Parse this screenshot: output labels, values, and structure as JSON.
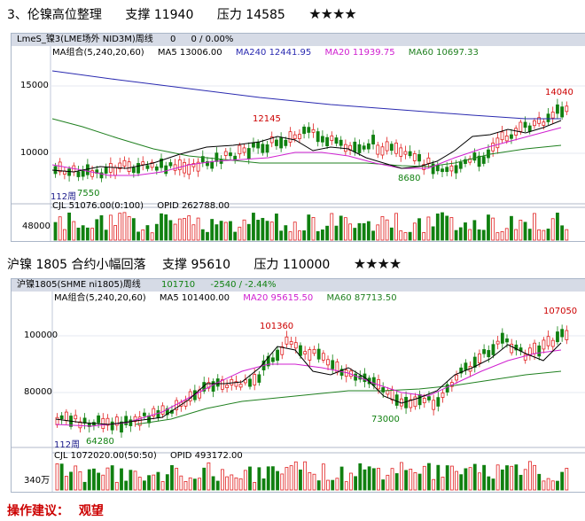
{
  "heading1": {
    "title": "3、伦镍高位整理",
    "support_label": "支撑",
    "support": "11940",
    "pressure_label": "压力",
    "pressure": "14585",
    "stars": "★★★★"
  },
  "panel1": {
    "title_bar": {
      "symbol": "LmeS_镍3(LME场外 NID3M)周线",
      "value": "0",
      "change": "0 / 0.00%"
    },
    "ma_row": {
      "label": "MA组合(5,240,20,60)",
      "ma5": "MA5 13006.00",
      "ma240": "MA240 12441.95",
      "ma20": "MA20 11939.75",
      "ma60": "MA60 10697.33"
    },
    "y_labels": [
      "15000",
      "10000"
    ],
    "peak_high": "14040",
    "mid_high": "12145",
    "low_mark": "8680",
    "period": "112周",
    "start_low": "7550",
    "volume_row": {
      "cjl": "CJL 51076.00(0:100)",
      "opid": "OPID 262788.00"
    },
    "vol_label": "48000"
  },
  "heading2": {
    "title": "沪镍 1805 合约小幅回落",
    "support_label": "支撑",
    "support": "95610",
    "pressure_label": "压力",
    "pressure": "110000",
    "stars": "★★★★"
  },
  "panel2": {
    "title_bar": {
      "symbol": "沪镍1805(SHME ni1805)周线",
      "value": "101710",
      "change": "-2540 / -2.44%"
    },
    "ma_row": {
      "label": "MA组合(5,240,20,60)",
      "ma5": "MA5 101400.00",
      "ma20": "MA20 95615.50",
      "ma60": "MA60 87713.50"
    },
    "y_labels": [
      "100000",
      "80000"
    ],
    "peak_high": "107050",
    "mid_high": "101360",
    "low_mark": "73000",
    "period": "112周",
    "start_low": "64280",
    "volume_row": {
      "cjl": "CJL 1072020.00(50:50)",
      "opid": "OPID 493172.00"
    },
    "vol_label": "340万"
  },
  "advice": {
    "label": "操作建议：",
    "value": "观望"
  },
  "colors": {
    "up": "#e02020",
    "down": "#108010",
    "ma5": "#000000",
    "ma240": "#2a2ab0",
    "ma20": "#d020d0",
    "ma60": "#208020",
    "bar": "#d6dbe6"
  }
}
